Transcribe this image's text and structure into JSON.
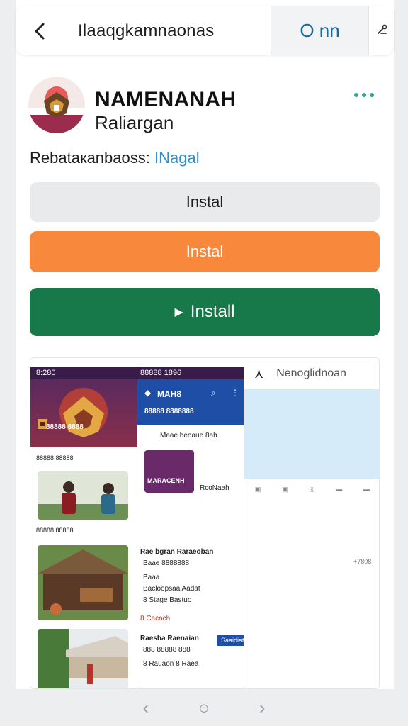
{
  "topbar": {
    "title": "Ilaaqgkamnaonas",
    "open_label": "O nn",
    "back_icon": "chevron-left-icon",
    "share_icon": "share-icon"
  },
  "app": {
    "name": "NAMENANAH",
    "developer": "Raliargan",
    "category_label": "Rebataкanbaoss:",
    "category_value": "INagal"
  },
  "buttons": {
    "grey_label": "Instal",
    "orange_label": "Instal",
    "green_label": "Install"
  },
  "screenshots": {
    "p1": {
      "status": "8:280",
      "hero_title": "88888 8888",
      "row1": "88888 88888",
      "row2": "88888 88888"
    },
    "p2": {
      "status": "88888 1896",
      "title": "MAH8",
      "subtitle": "88888 8888888",
      "link": "Maae beoaue 8ah",
      "card_label": "MARACENH",
      "card_side": "RcoNaah",
      "line1": "Rae bgran Raraeoban",
      "line2": "Baae   8888888",
      "line3": "Baaa",
      "line4": "Bacloopsaa Aadat",
      "line5": "8 Stage Bastuo",
      "section": "8 Cacach",
      "line6": "Raesha Raenaian",
      "line7": "888 88888 888",
      "line8": "8 Rauaon 8 Raea",
      "badge": "Saaidiat"
    },
    "p3": {
      "title": "Nenoglidnoan",
      "side1": "+7808"
    }
  },
  "colors": {
    "accent_green": "#17784a",
    "accent_orange": "#f7883c",
    "link_blue": "#2b8fd3"
  }
}
